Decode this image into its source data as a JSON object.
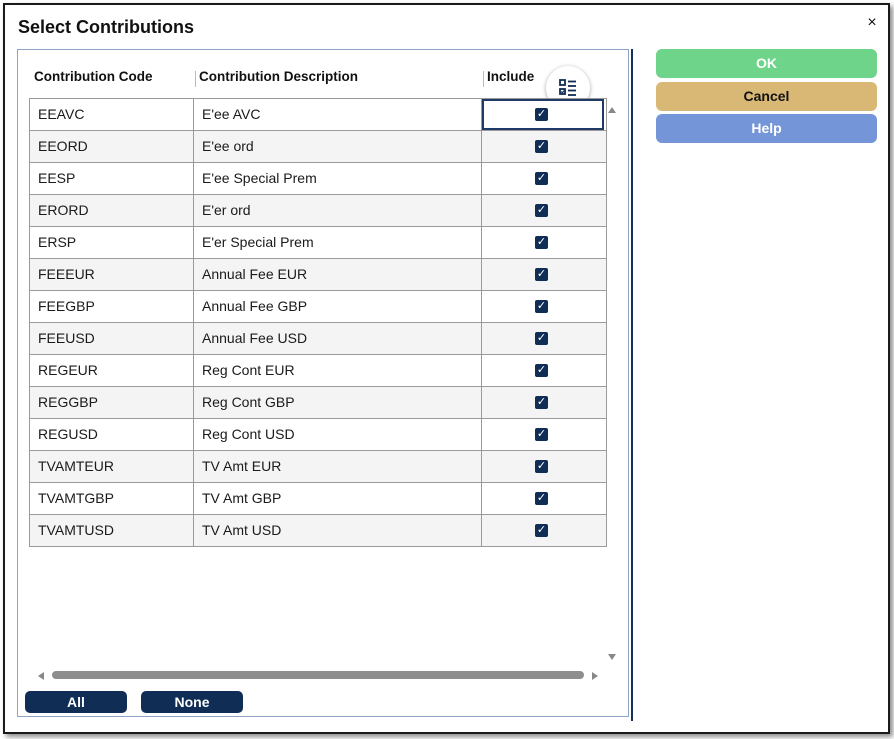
{
  "dialog": {
    "title": "Select Contributions",
    "close_glyph": "×"
  },
  "table": {
    "headers": {
      "code": "Contribution Code",
      "description": "Contribution Description",
      "include": "Include"
    },
    "rows": [
      {
        "code": "EEAVC",
        "description": "E'ee AVC",
        "include": true
      },
      {
        "code": "EEORD",
        "description": "E'ee ord",
        "include": true
      },
      {
        "code": "EESP",
        "description": "E'ee Special Prem",
        "include": true
      },
      {
        "code": "ERORD",
        "description": "E'er ord",
        "include": true
      },
      {
        "code": "ERSP",
        "description": "E'er Special Prem",
        "include": true
      },
      {
        "code": "FEEEUR",
        "description": "Annual Fee EUR",
        "include": true
      },
      {
        "code": "FEEGBP",
        "description": "Annual Fee GBP",
        "include": true
      },
      {
        "code": "FEEUSD",
        "description": "Annual Fee USD",
        "include": true
      },
      {
        "code": "REGEUR",
        "description": "Reg Cont EUR",
        "include": true
      },
      {
        "code": "REGGBP",
        "description": "Reg Cont GBP",
        "include": true
      },
      {
        "code": "REGUSD",
        "description": "Reg Cont USD",
        "include": true
      },
      {
        "code": "TVAMTEUR",
        "description": "TV Amt EUR",
        "include": true
      },
      {
        "code": "TVAMTGBP",
        "description": "TV Amt GBP",
        "include": true
      },
      {
        "code": "TVAMTUSD",
        "description": "TV Amt USD",
        "include": true
      }
    ],
    "check_glyph": "✓",
    "column_chooser_icon": "column-chooser-icon"
  },
  "selection_buttons": {
    "all": "All",
    "none": "None"
  },
  "actions": {
    "ok": "OK",
    "cancel": "Cancel",
    "help": "Help",
    "colors": {
      "ok": "#6dd48a",
      "cancel": "#d9b876",
      "help": "#7595d9"
    }
  }
}
